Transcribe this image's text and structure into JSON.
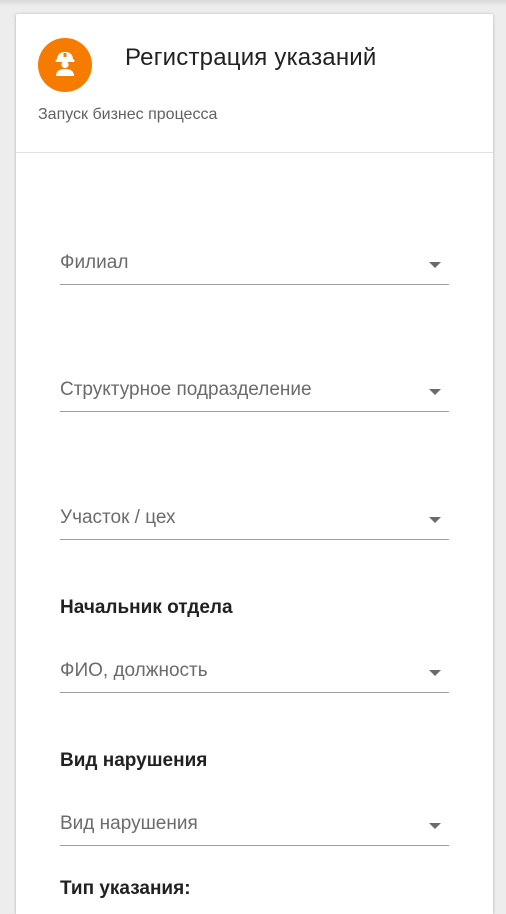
{
  "header": {
    "title": "Регистрация указаний",
    "subtitle": "Запуск бизнес процесса",
    "avatar_icon": "worker-helmet-icon",
    "accent_color": "#f57c00"
  },
  "form": {
    "branch": {
      "placeholder": "Филиал"
    },
    "division": {
      "placeholder": "Структурное подразделение"
    },
    "workshop": {
      "placeholder": "Участок / цех"
    },
    "head": {
      "label": "Начальник отдела",
      "placeholder": "ФИО, должность"
    },
    "violation": {
      "label": "Вид нарушения",
      "placeholder": "Вид нарушения"
    },
    "instruction_type": {
      "label": "Тип указания:"
    }
  }
}
